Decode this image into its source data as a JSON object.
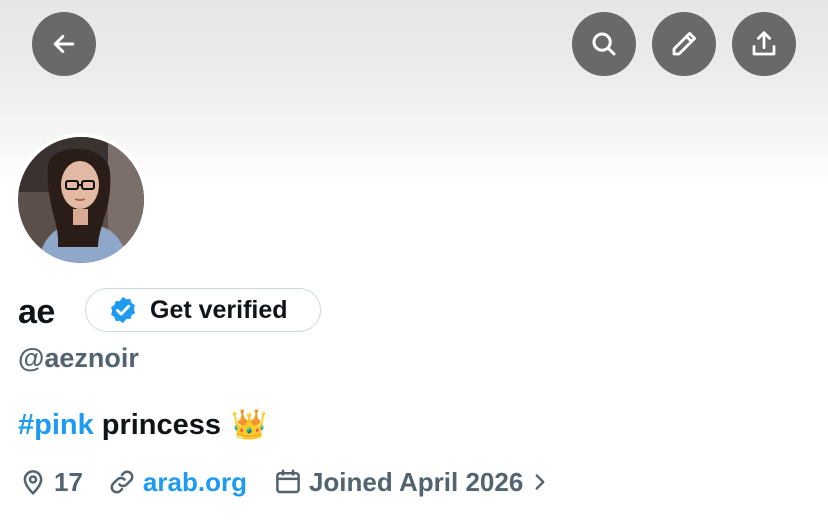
{
  "header": {
    "back_icon": "arrow-left-icon",
    "search_icon": "search-icon",
    "edit_icon": "pencil-icon",
    "share_icon": "share-icon"
  },
  "profile": {
    "display_name": "ae",
    "verify_label": "Get verified",
    "handle": "@aeznoir",
    "bio": {
      "hashtag": "#pink",
      "text": "princess",
      "emoji": "👑"
    },
    "location": "17",
    "website": "arab.org",
    "joined": "Joined April 2026"
  },
  "colors": {
    "accent": "#1d9bf0",
    "text_primary": "#0f1419",
    "text_secondary": "#536471",
    "button_bg": "#525252"
  }
}
